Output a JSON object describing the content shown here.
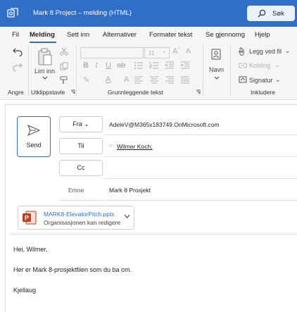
{
  "window": {
    "title": "Mark 8 Project – melding (HTML)"
  },
  "search": {
    "label": "Søk"
  },
  "menu": [
    {
      "label": "Fil"
    },
    {
      "label": "Melding"
    },
    {
      "label": "Sett inn"
    },
    {
      "label": "Alternativer"
    },
    {
      "label": "Formater tekst"
    },
    {
      "label": "Se gjennomgang"
    },
    {
      "label": "Hjelp"
    }
  ],
  "ribbon": {
    "groups": {
      "undo": "Angre",
      "clipboard": "Utklippstavle",
      "basic_text": "Grunnleggende tekst",
      "include": "Inkludere"
    },
    "paste_label": "Lim inn",
    "font_size": "11",
    "names_label": "Navn",
    "attach_file_label": "Legg ved fil",
    "link_label": "Kobling",
    "signature_label": "Signatur"
  },
  "compose": {
    "send_label": "Send",
    "from_label": "Fra",
    "from_value": "AdeleV@M365x183749.OnMicrosoft.com",
    "to_label": "Til",
    "to_value": "Wilmer Koch;",
    "cc_label": "Cc",
    "subject_label": "Emne",
    "subject_value": "Mark 8 Prosjekt"
  },
  "attachment": {
    "filename": "MARK8-ElevatorPitch.pptx",
    "permission": "Organisasjonen kan redigere",
    "icon": "powerpoint-icon"
  },
  "body": {
    "greeting": "Hei, Wilmer,",
    "line1": "Her er Mark 8-prosjektfilen som du ba om.",
    "signature": "Kjellaug"
  },
  "colors": {
    "accent": "#2f6fc7",
    "ppt": "#c43e1c"
  }
}
